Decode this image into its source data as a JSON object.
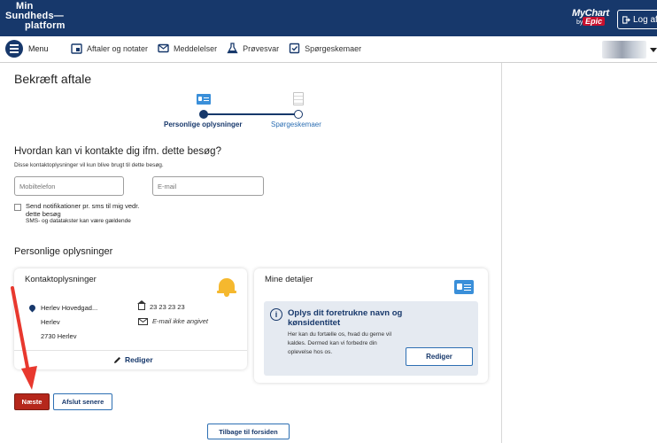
{
  "header": {
    "brand_line1": "Min",
    "brand_line2": "Sundheds—",
    "brand_line3": "platform",
    "mychart_label": "MyChart",
    "mychart_by": "by",
    "epic_label": "Epic",
    "logout_label": "Log af",
    "bg_color": "#17386b"
  },
  "nav": {
    "menu_label": "Menu",
    "items": [
      {
        "label": "Aftaler og notater",
        "icon": "calendar-notes-icon"
      },
      {
        "label": "Meddelelser",
        "icon": "envelope-icon"
      },
      {
        "label": "Prøvesvar",
        "icon": "flask-icon"
      },
      {
        "label": "Spørgeskemaer",
        "icon": "checklist-icon"
      }
    ]
  },
  "page": {
    "title": "Bekræft aftale",
    "steps": [
      {
        "label": "Personlige oplysninger",
        "state": "active"
      },
      {
        "label": "Spørgeskemaer",
        "state": "pending"
      }
    ],
    "contact_question": "Hvordan kan vi kontakte dig ifm. dette besøg?",
    "contact_hint": "Disse kontaktoplysninger vil kun blive brugt til dette besøg.",
    "phone_placeholder": "Mobiltelefon",
    "phone_value": "",
    "email_placeholder": "E-mail",
    "email_value": "",
    "sms_checkbox_label": "Send notifikationer pr. sms til mig vedr. dette besøg",
    "sms_checked": false,
    "sms_note": "SMS- og datatakster kan være gældende",
    "personal_section_title": "Personlige oplysninger"
  },
  "contact_card": {
    "title": "Kontaktoplysninger",
    "address_line1": "Herlev Hovedgad...",
    "address_line2": "Herlev",
    "address_line3": "2730 Herlev",
    "phone": "23 23 23 23",
    "email": "E-mail ikke angivet",
    "edit_label": "Rediger"
  },
  "details_card": {
    "title": "Mine detaljer",
    "info_title": "Oplys dit foretrukne navn og kønsidentitet",
    "info_text": "Her kan du fortælle os, hvad du gerne vil kaldes. Dermed kan vi forbedre din oplevelse hos os.",
    "edit_label": "Rediger",
    "info_icon": "i"
  },
  "buttons": {
    "next": "Næste",
    "finish_later": "Afslut senere",
    "back_home": "Tilbage til forsiden"
  },
  "colors": {
    "primary": "#17386b",
    "accent_red": "#b5271b",
    "annotation_arrow": "#e8382e"
  }
}
